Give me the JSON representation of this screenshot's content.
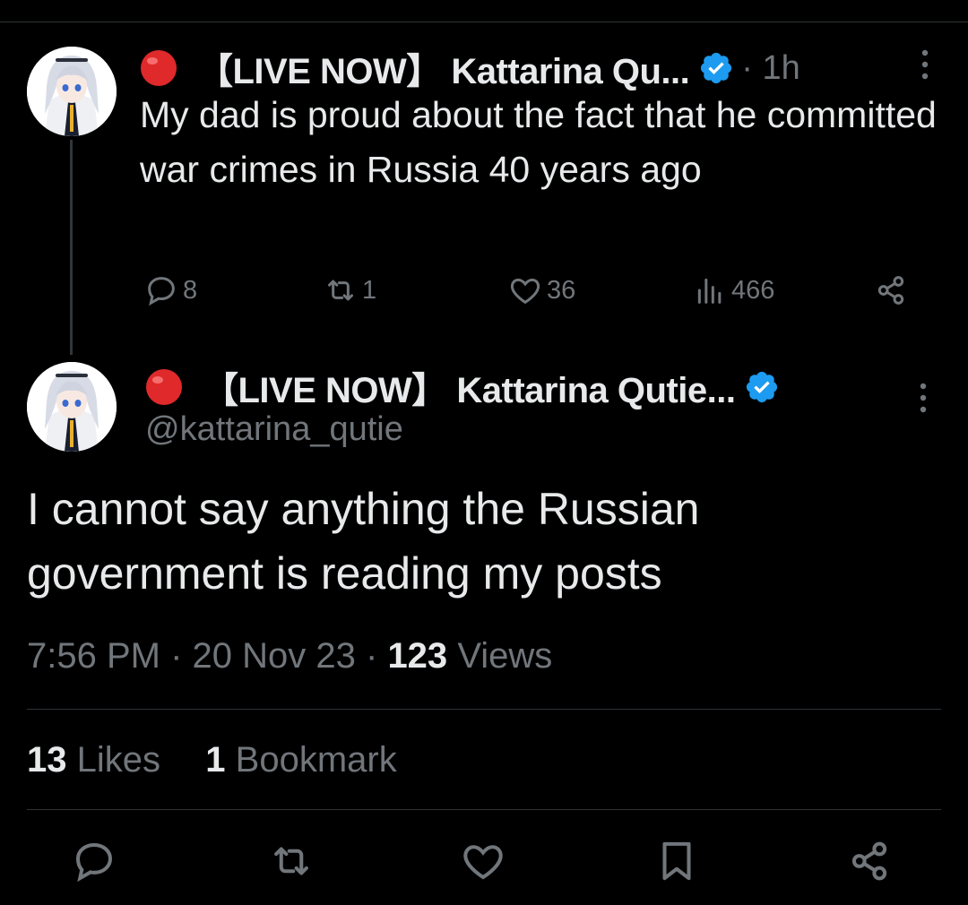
{
  "parent_tweet": {
    "live_emoji": "🔴",
    "display_name": "【LIVE NOW】 Kattarina Qu...",
    "time": "· 1h",
    "text": "My dad is proud about the fact that he committed war crimes in Russia 40 years ago",
    "replies": "8",
    "retweets": "1",
    "likes": "36",
    "views": "466"
  },
  "main_tweet": {
    "live_emoji": "🔴",
    "display_name": "【LIVE NOW】 Kattarina Qutie...",
    "handle": "@kattarina_qutie",
    "text": "I cannot say anything the Russian government is reading my posts",
    "time": "7:56 PM",
    "date": "20 Nov 23",
    "views_count": "123",
    "views_label": "Views",
    "likes_count": "13",
    "likes_label": "Likes",
    "bookmarks_count": "1",
    "bookmarks_label": "Bookmark"
  },
  "colors": {
    "background": "#000000",
    "text": "#e7e9ea",
    "muted": "#71767b",
    "verified": "#1d9bf0",
    "live_red": "#e0292a"
  },
  "icons": [
    "live-dot-icon",
    "verified-badge-icon",
    "more-icon",
    "reply-icon",
    "retweet-icon",
    "like-icon",
    "views-icon",
    "share-icon",
    "bookmark-icon"
  ]
}
